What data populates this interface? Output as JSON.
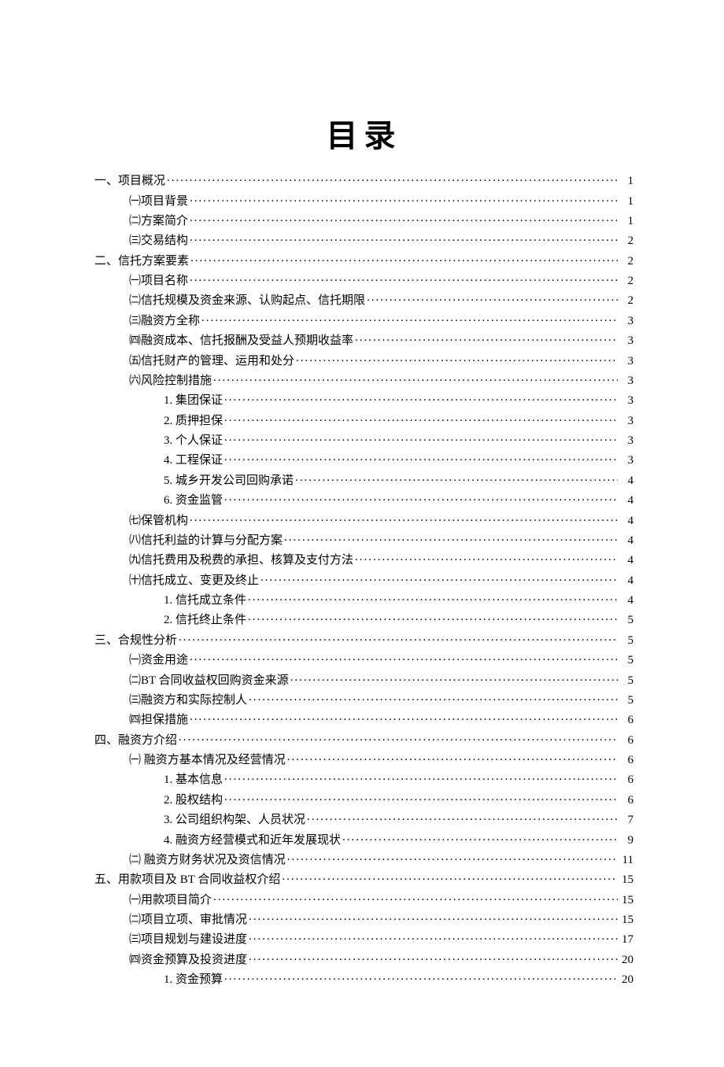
{
  "title": "目录",
  "toc": [
    {
      "indent": 0,
      "label": "一、项目概况",
      "page": "1"
    },
    {
      "indent": 1,
      "label": "㈠项目背景",
      "page": "1"
    },
    {
      "indent": 1,
      "label": "㈡方案简介",
      "page": "1"
    },
    {
      "indent": 1,
      "label": "㈢交易结构",
      "page": "2"
    },
    {
      "indent": 0,
      "label": "二、信托方案要素",
      "page": "2"
    },
    {
      "indent": 1,
      "label": "㈠项目名称",
      "page": "2"
    },
    {
      "indent": 1,
      "label": "㈡信托规模及资金来源、认购起点、信托期限",
      "page": "2"
    },
    {
      "indent": 1,
      "label": "㈢融资方全称",
      "page": "3"
    },
    {
      "indent": 1,
      "label": "㈣融资成本、信托报酬及受益人预期收益率",
      "page": "3"
    },
    {
      "indent": 1,
      "label": "㈤信托财产的管理、运用和处分",
      "page": "3"
    },
    {
      "indent": 1,
      "label": "㈥风险控制措施",
      "page": "3"
    },
    {
      "indent": 2,
      "label": "1. 集团保证",
      "page": "3"
    },
    {
      "indent": 2,
      "label": "2. 质押担保",
      "page": "3"
    },
    {
      "indent": 2,
      "label": "3. 个人保证",
      "page": "3"
    },
    {
      "indent": 2,
      "label": "4. 工程保证",
      "page": "3"
    },
    {
      "indent": 2,
      "label": "5. 城乡开发公司回购承诺",
      "page": "4"
    },
    {
      "indent": 2,
      "label": "6. 资金监管",
      "page": "4"
    },
    {
      "indent": 1,
      "label": "㈦保管机构",
      "page": "4"
    },
    {
      "indent": 1,
      "label": "㈧信托利益的计算与分配方案",
      "page": "4"
    },
    {
      "indent": 1,
      "label": "㈨信托费用及税费的承担、核算及支付方法",
      "page": "4"
    },
    {
      "indent": 1,
      "label": "㈩信托成立、变更及终止",
      "page": "4"
    },
    {
      "indent": 2,
      "label": "1. 信托成立条件",
      "page": "4"
    },
    {
      "indent": 2,
      "label": "2. 信托终止条件",
      "page": "5"
    },
    {
      "indent": 0,
      "label": "三、合规性分析",
      "page": "5"
    },
    {
      "indent": 1,
      "label": "㈠资金用途",
      "page": "5"
    },
    {
      "indent": 1,
      "label": "㈡BT 合同收益权回购资金来源",
      "page": "5"
    },
    {
      "indent": 1,
      "label": "㈢融资方和实际控制人",
      "page": "5"
    },
    {
      "indent": 1,
      "label": "㈣担保措施",
      "page": "6"
    },
    {
      "indent": 0,
      "label": "四、融资方介绍",
      "page": "6"
    },
    {
      "indent": 1,
      "label": "㈠ 融资方基本情况及经营情况",
      "page": "6"
    },
    {
      "indent": 2,
      "label": "1. 基本信息",
      "page": "6"
    },
    {
      "indent": 2,
      "label": "2. 股权结构",
      "page": "6"
    },
    {
      "indent": 2,
      "label": "3. 公司组织构架、人员状况",
      "page": "7"
    },
    {
      "indent": 2,
      "label": "4. 融资方经营模式和近年发展现状",
      "page": "9"
    },
    {
      "indent": 1,
      "label": "㈡ 融资方财务状况及资信情况",
      "page": "11"
    },
    {
      "indent": 0,
      "label": "五、用款项目及 BT 合同收益权介绍",
      "page": "15"
    },
    {
      "indent": 1,
      "label": "㈠用款项目简介",
      "page": "15"
    },
    {
      "indent": 1,
      "label": "㈡项目立项、审批情况",
      "page": "15"
    },
    {
      "indent": 1,
      "label": "㈢项目规划与建设进度",
      "page": "17"
    },
    {
      "indent": 1,
      "label": "㈣资金预算及投资进度",
      "page": "20"
    },
    {
      "indent": 2,
      "label": "1. 资金预算",
      "page": "20"
    }
  ]
}
